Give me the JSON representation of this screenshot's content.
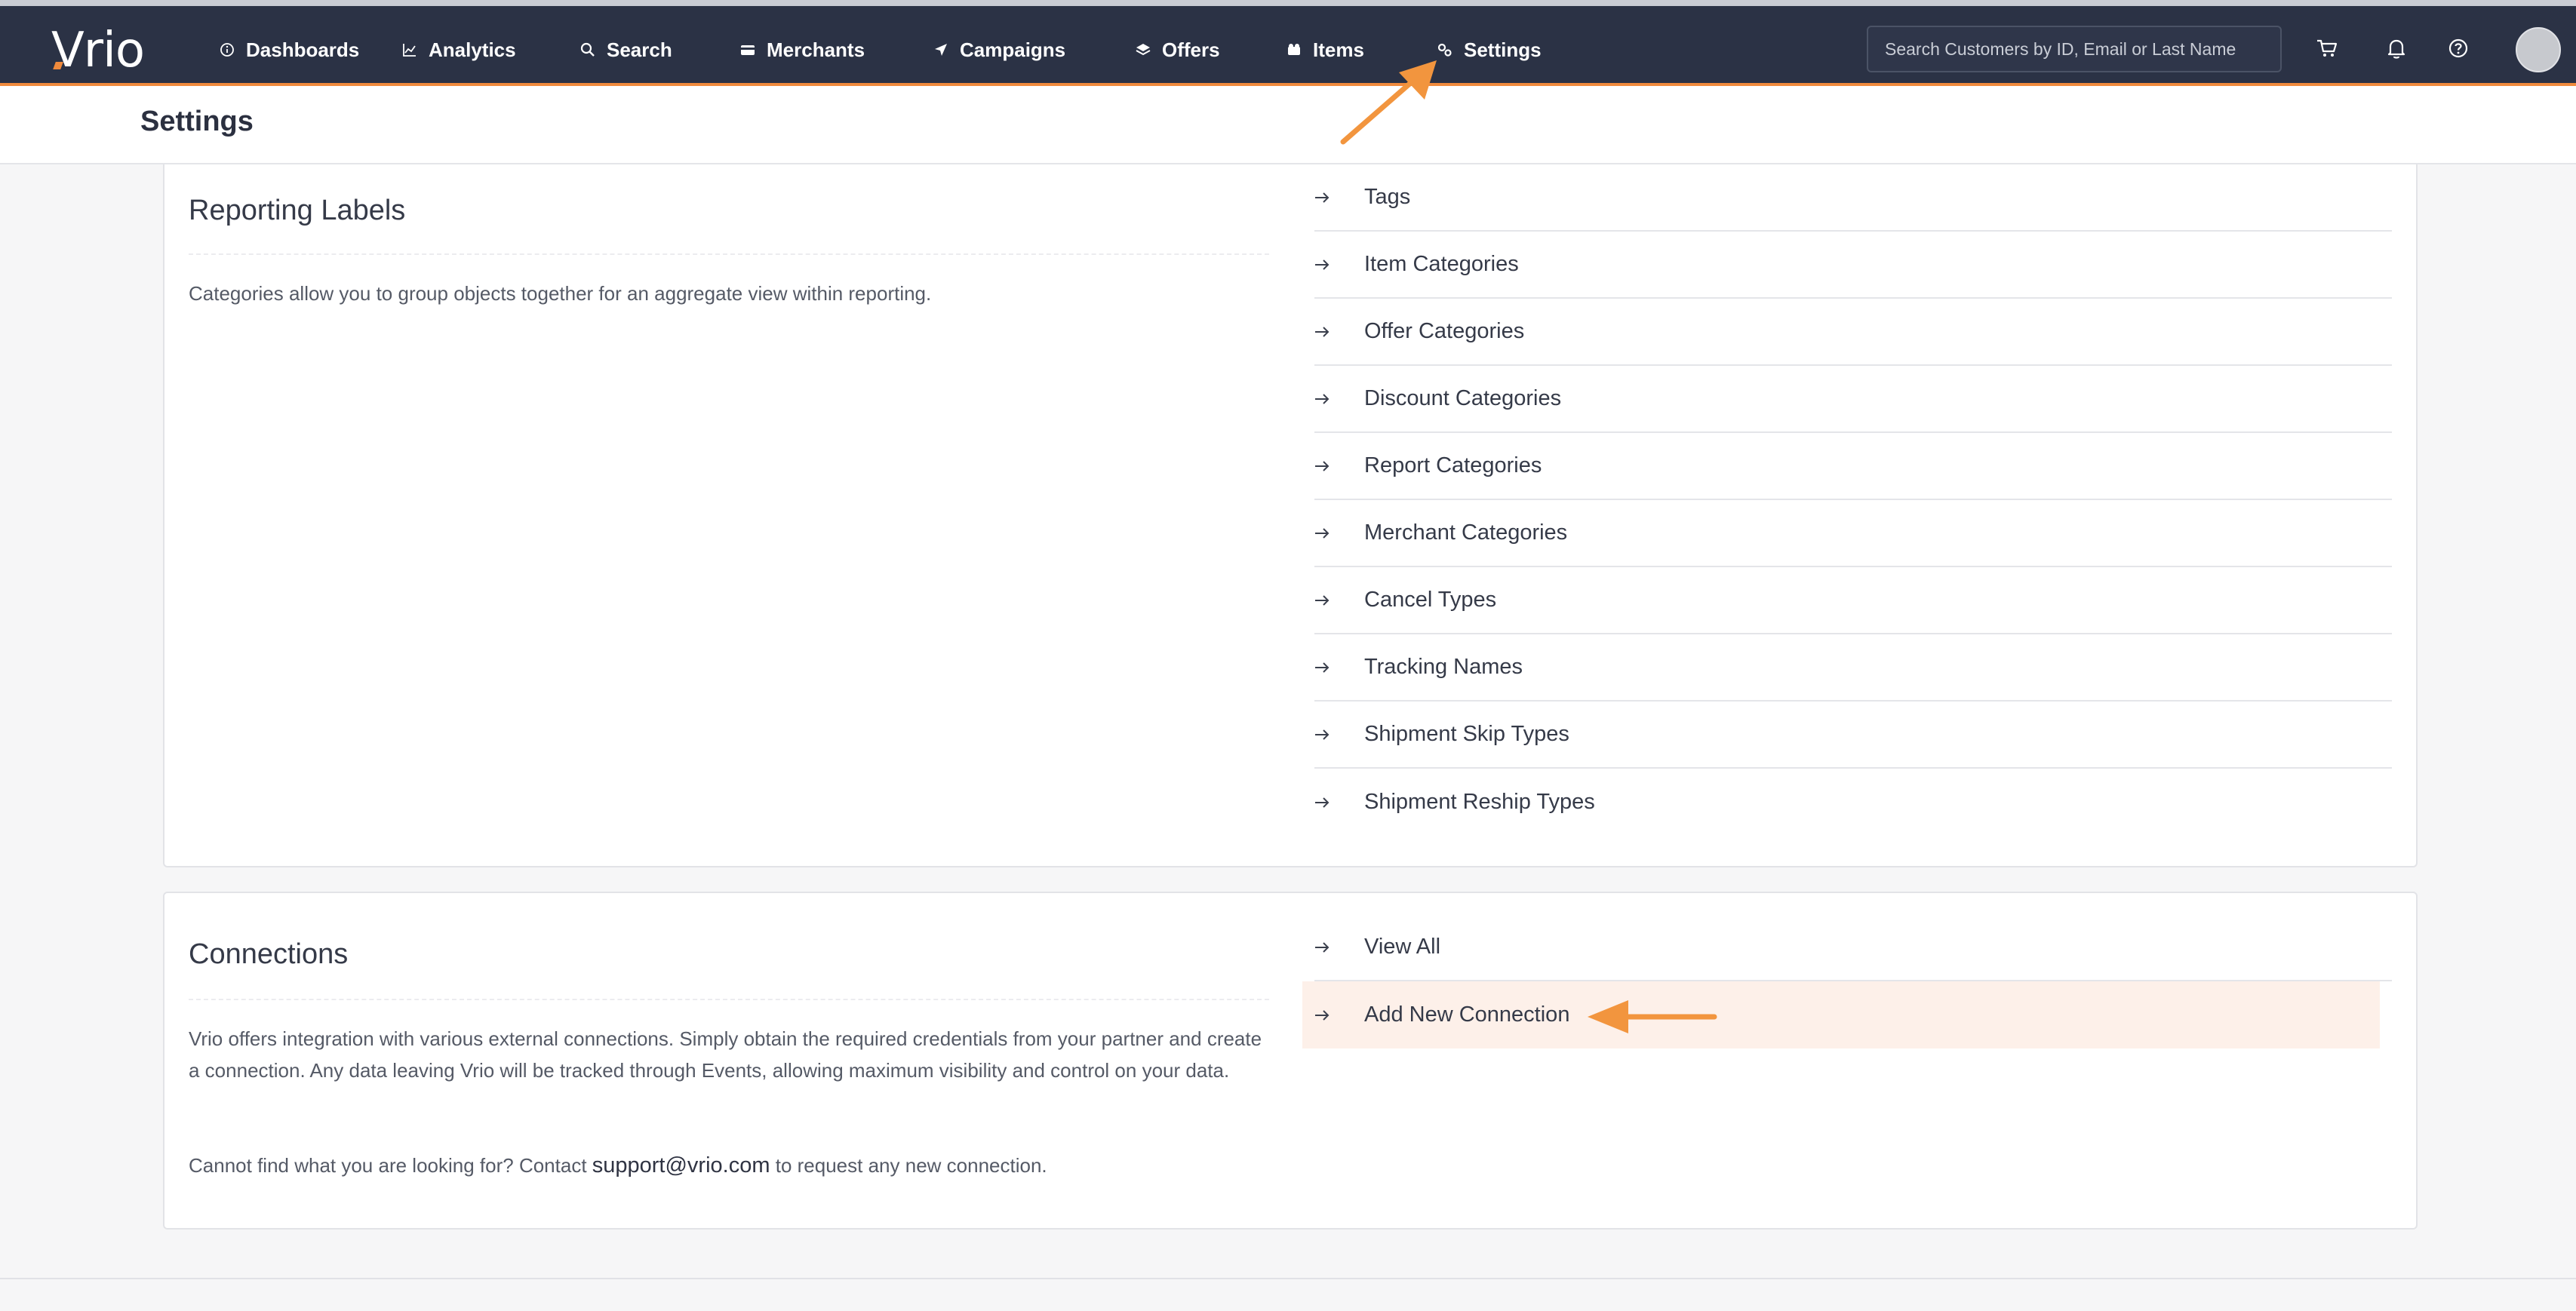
{
  "app": {
    "logo_text": "Vrio"
  },
  "nav": {
    "items": [
      {
        "label": "Dashboards",
        "icon": "info-circle-icon"
      },
      {
        "label": "Analytics",
        "icon": "line-chart-icon"
      },
      {
        "label": "Search",
        "icon": "search-icon"
      },
      {
        "label": "Merchants",
        "icon": "credit-card-icon"
      },
      {
        "label": "Campaigns",
        "icon": "paper-plane-icon"
      },
      {
        "label": "Offers",
        "icon": "layers-icon"
      },
      {
        "label": "Items",
        "icon": "box-icon"
      },
      {
        "label": "Settings",
        "icon": "gears-icon",
        "active": true
      }
    ],
    "search_placeholder": "Search Customers by ID, Email or Last Name",
    "right_icons": [
      "cart-icon",
      "bell-icon",
      "help-circle-icon",
      "avatar"
    ]
  },
  "page": {
    "title": "Settings"
  },
  "reporting_labels": {
    "title": "Reporting Labels",
    "description": "Categories allow you to group objects together for an aggregate view within reporting.",
    "links": [
      "Tags",
      "Item Categories",
      "Offer Categories",
      "Discount Categories",
      "Report Categories",
      "Merchant Categories",
      "Cancel Types",
      "Tracking Names",
      "Shipment Skip Types",
      "Shipment Reship Types"
    ]
  },
  "connections": {
    "title": "Connections",
    "description": "Vrio offers integration with various external connections. Simply obtain the required credentials from your partner and create a connection. Any data leaving Vrio will be tracked through Events, allowing maximum visibility and control on your data.",
    "contact_prefix": "Cannot find what you are looking for? Contact ",
    "contact_email": "support@vrio.com",
    "contact_suffix": " to request any new connection.",
    "links": [
      "View All",
      "Add New Connection"
    ]
  },
  "colors": {
    "topbar": "#2b3245",
    "accent": "#f08a3c",
    "highlight_row": "#fdf0e9",
    "background": "#f6f6f7"
  }
}
